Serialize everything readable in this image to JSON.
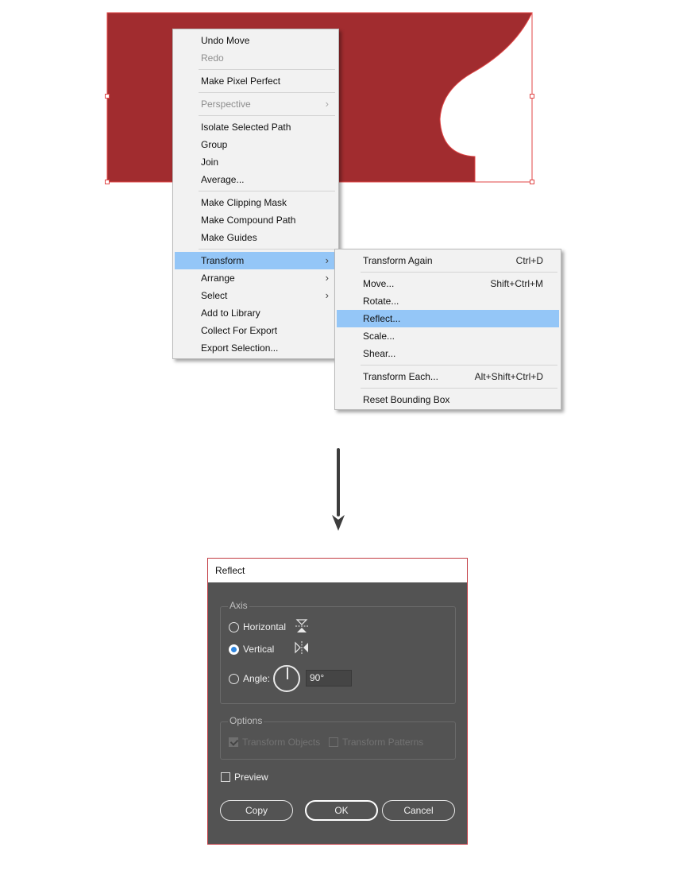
{
  "colors": {
    "artwork_fill": "#a12c2f",
    "selection": "#e04646",
    "menu_highlight": "#94c6f7",
    "dialog_bg": "#535353",
    "radio_selected": "#2f86df"
  },
  "context_menu": {
    "items": [
      {
        "label": "Undo Move"
      },
      {
        "label": "Redo",
        "disabled": true
      },
      {
        "label": "Make Pixel Perfect"
      },
      {
        "label": "Perspective",
        "disabled": true,
        "submenu": true
      },
      {
        "label": "Isolate Selected Path"
      },
      {
        "label": "Group"
      },
      {
        "label": "Join"
      },
      {
        "label": "Average..."
      },
      {
        "label": "Make Clipping Mask"
      },
      {
        "label": "Make Compound Path"
      },
      {
        "label": "Make Guides"
      },
      {
        "label": "Transform",
        "submenu": true,
        "highlighted": true
      },
      {
        "label": "Arrange",
        "submenu": true
      },
      {
        "label": "Select",
        "submenu": true
      },
      {
        "label": "Add to Library"
      },
      {
        "label": "Collect For Export"
      },
      {
        "label": "Export Selection..."
      }
    ],
    "submenu_arrow": "›"
  },
  "transform_submenu": {
    "items": [
      {
        "label": "Transform Again",
        "shortcut": "Ctrl+D"
      },
      {
        "label": "Move...",
        "shortcut": "Shift+Ctrl+M"
      },
      {
        "label": "Rotate...",
        "shortcut": ""
      },
      {
        "label": "Reflect...",
        "shortcut": "",
        "highlighted": true
      },
      {
        "label": "Scale...",
        "shortcut": ""
      },
      {
        "label": "Shear...",
        "shortcut": ""
      },
      {
        "label": "Transform Each...",
        "shortcut": "Alt+Shift+Ctrl+D"
      },
      {
        "label": "Reset Bounding Box",
        "shortcut": ""
      }
    ]
  },
  "icons": {
    "arrow": "down-arrow-icon",
    "horizontal": "reflect-horizontal-icon",
    "vertical": "reflect-vertical-icon",
    "angle": "angle-dial-icon"
  },
  "reflect_dialog": {
    "title": "Reflect",
    "axis_label": "Axis",
    "horizontal_label": "Horizontal",
    "vertical_label": "Vertical",
    "angle_label": "Angle:",
    "angle_value": "90°",
    "selected_axis": "vertical",
    "options_label": "Options",
    "transform_objects_label": "Transform Objects",
    "transform_patterns_label": "Transform Patterns",
    "preview_label": "Preview",
    "copy_label": "Copy",
    "ok_label": "OK",
    "cancel_label": "Cancel"
  }
}
